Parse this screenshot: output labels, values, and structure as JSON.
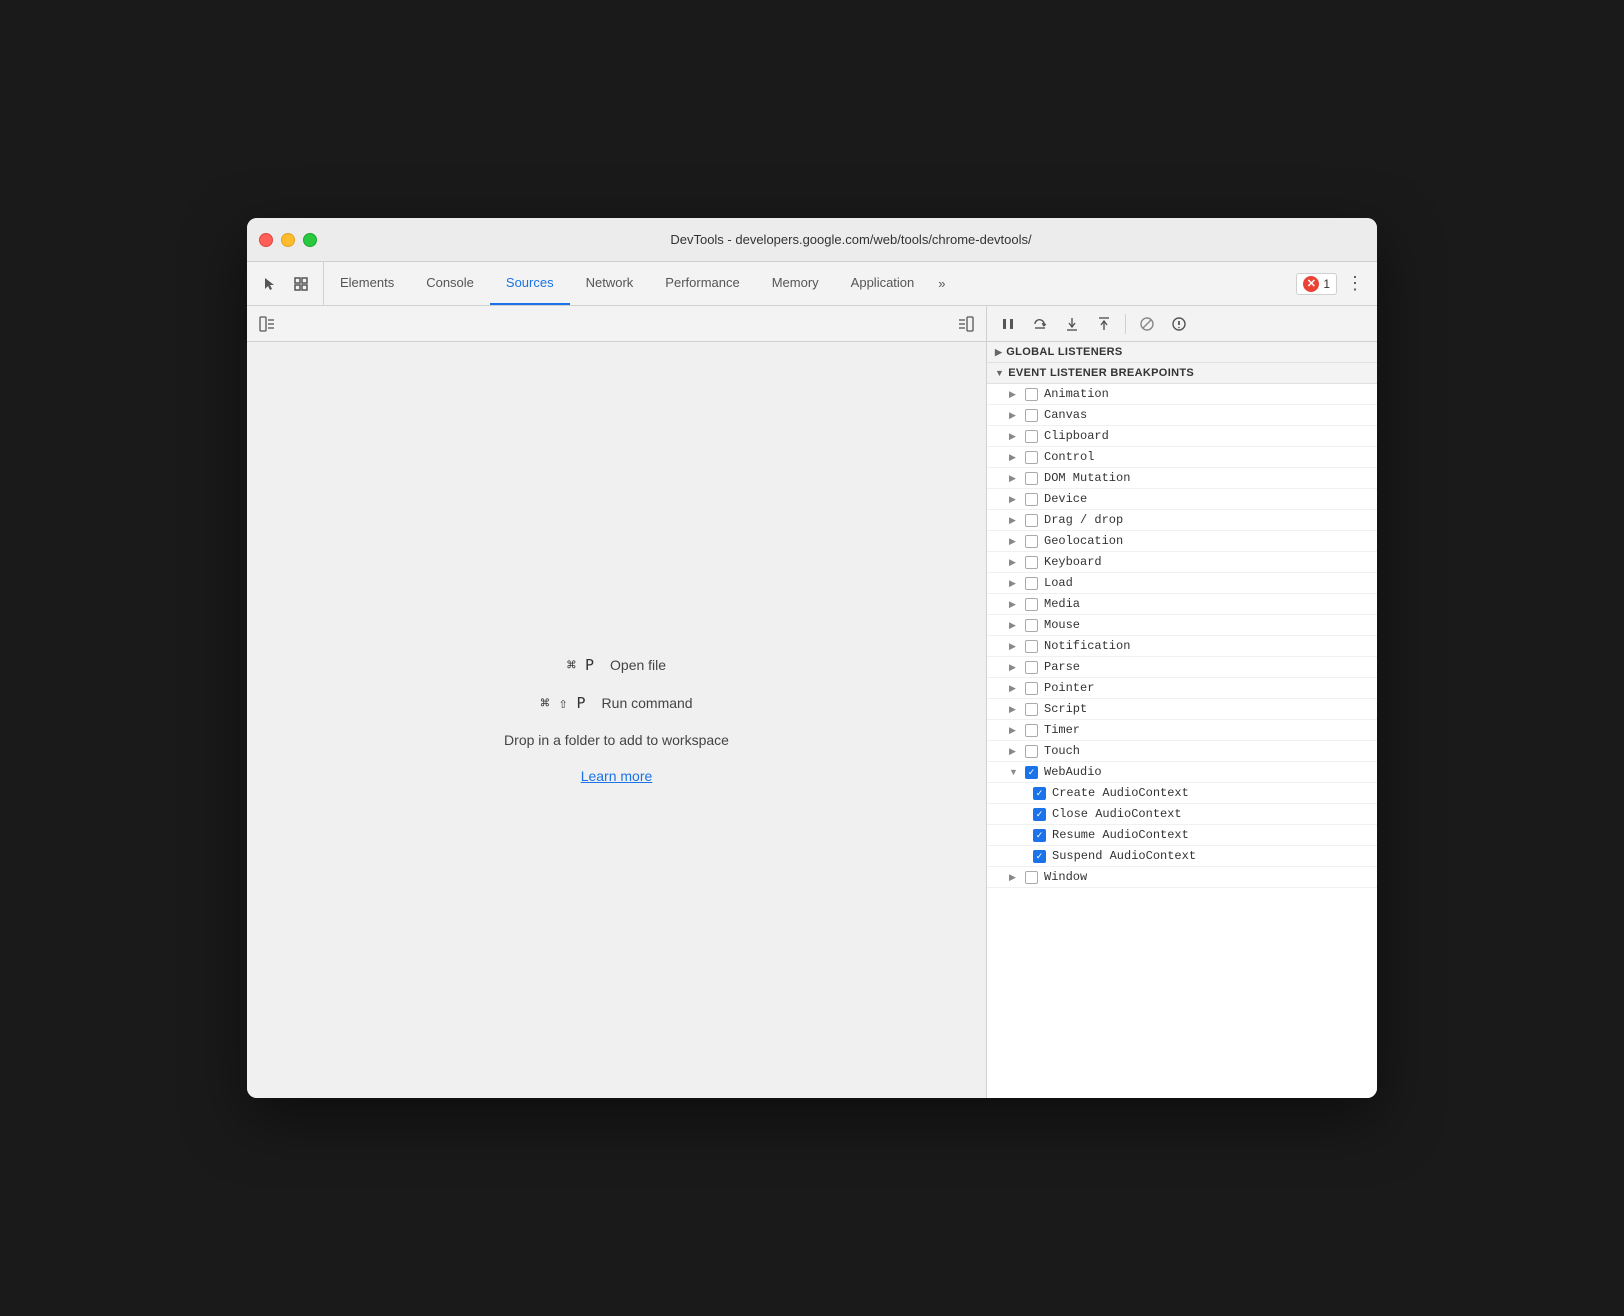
{
  "window": {
    "title": "DevTools - developers.google.com/web/tools/chrome-devtools/"
  },
  "traffic_lights": {
    "red_label": "close",
    "yellow_label": "minimize",
    "green_label": "maximize"
  },
  "tabs": [
    {
      "id": "elements",
      "label": "Elements",
      "active": false
    },
    {
      "id": "console",
      "label": "Console",
      "active": false
    },
    {
      "id": "sources",
      "label": "Sources",
      "active": true
    },
    {
      "id": "network",
      "label": "Network",
      "active": false
    },
    {
      "id": "performance",
      "label": "Performance",
      "active": false
    },
    {
      "id": "memory",
      "label": "Memory",
      "active": false
    },
    {
      "id": "application",
      "label": "Application",
      "active": false
    }
  ],
  "toolbar": {
    "more_label": "»",
    "error_count": "1",
    "more_options_label": "⋮"
  },
  "workspace": {
    "shortcut1_keys": "⌘ P",
    "shortcut1_label": "Open file",
    "shortcut2_keys": "⌘ ⇧ P",
    "shortcut2_label": "Run command",
    "drop_text": "Drop in a folder to add to workspace",
    "learn_more": "Learn more"
  },
  "debugger": {
    "buttons": [
      "pause",
      "step-over",
      "step-into",
      "step-out",
      "deactivate",
      "pause-on-exceptions"
    ]
  },
  "breakpoints": {
    "section_label": "Event Listener Breakpoints",
    "items": [
      {
        "id": "animation",
        "label": "Animation",
        "checked": false,
        "expanded": false
      },
      {
        "id": "canvas",
        "label": "Canvas",
        "checked": false,
        "expanded": false
      },
      {
        "id": "clipboard",
        "label": "Clipboard",
        "checked": false,
        "expanded": false
      },
      {
        "id": "control",
        "label": "Control",
        "checked": false,
        "expanded": false
      },
      {
        "id": "dom-mutation",
        "label": "DOM Mutation",
        "checked": false,
        "expanded": false
      },
      {
        "id": "device",
        "label": "Device",
        "checked": false,
        "expanded": false
      },
      {
        "id": "drag-drop",
        "label": "Drag / drop",
        "checked": false,
        "expanded": false
      },
      {
        "id": "geolocation",
        "label": "Geolocation",
        "checked": false,
        "expanded": false
      },
      {
        "id": "keyboard",
        "label": "Keyboard",
        "checked": false,
        "expanded": false
      },
      {
        "id": "load",
        "label": "Load",
        "checked": false,
        "expanded": false
      },
      {
        "id": "media",
        "label": "Media",
        "checked": false,
        "expanded": false
      },
      {
        "id": "mouse",
        "label": "Mouse",
        "checked": false,
        "expanded": false
      },
      {
        "id": "notification",
        "label": "Notification",
        "checked": false,
        "expanded": false
      },
      {
        "id": "parse",
        "label": "Parse",
        "checked": false,
        "expanded": false
      },
      {
        "id": "pointer",
        "label": "Pointer",
        "checked": false,
        "expanded": false
      },
      {
        "id": "script",
        "label": "Script",
        "checked": false,
        "expanded": false
      },
      {
        "id": "timer",
        "label": "Timer",
        "checked": false,
        "expanded": false
      },
      {
        "id": "touch",
        "label": "Touch",
        "checked": false,
        "expanded": false
      },
      {
        "id": "webaudio",
        "label": "WebAudio",
        "checked": true,
        "expanded": true
      },
      {
        "id": "window",
        "label": "Window",
        "checked": false,
        "expanded": false
      }
    ],
    "webaudio_children": [
      {
        "id": "create-audiocontext",
        "label": "Create AudioContext",
        "checked": true
      },
      {
        "id": "close-audiocontext",
        "label": "Close AudioContext",
        "checked": true
      },
      {
        "id": "resume-audiocontext",
        "label": "Resume AudioContext",
        "checked": true
      },
      {
        "id": "suspend-audiocontext",
        "label": "Suspend AudioContext",
        "checked": true
      }
    ]
  },
  "global_listeners": {
    "label": "Global Listeners"
  }
}
